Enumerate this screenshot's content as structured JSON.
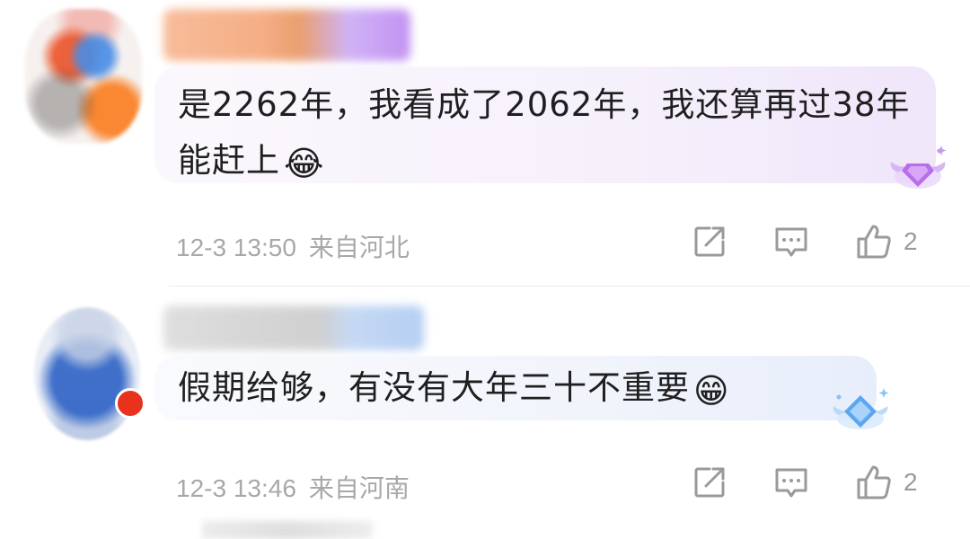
{
  "comments": [
    {
      "text": "是2262年，我看成了2062年，我还算再过38年能赶上",
      "emoji": "😂",
      "emoji_name": "laughing-crying-emoji",
      "date": "12-3 13:50",
      "location": "来自河北",
      "likes": "2",
      "ornament_color": "#b86ee8"
    },
    {
      "text": "假期给够，有没有大年三十不重要",
      "emoji": "😁",
      "emoji_name": "grinning-emoji",
      "date": "12-3 13:46",
      "location": "来自河南",
      "likes": "2",
      "ornament_color": "#5aa6f0"
    }
  ],
  "icons": {
    "share": "share-icon",
    "reply": "comment-icon",
    "like": "thumbs-up-icon"
  }
}
